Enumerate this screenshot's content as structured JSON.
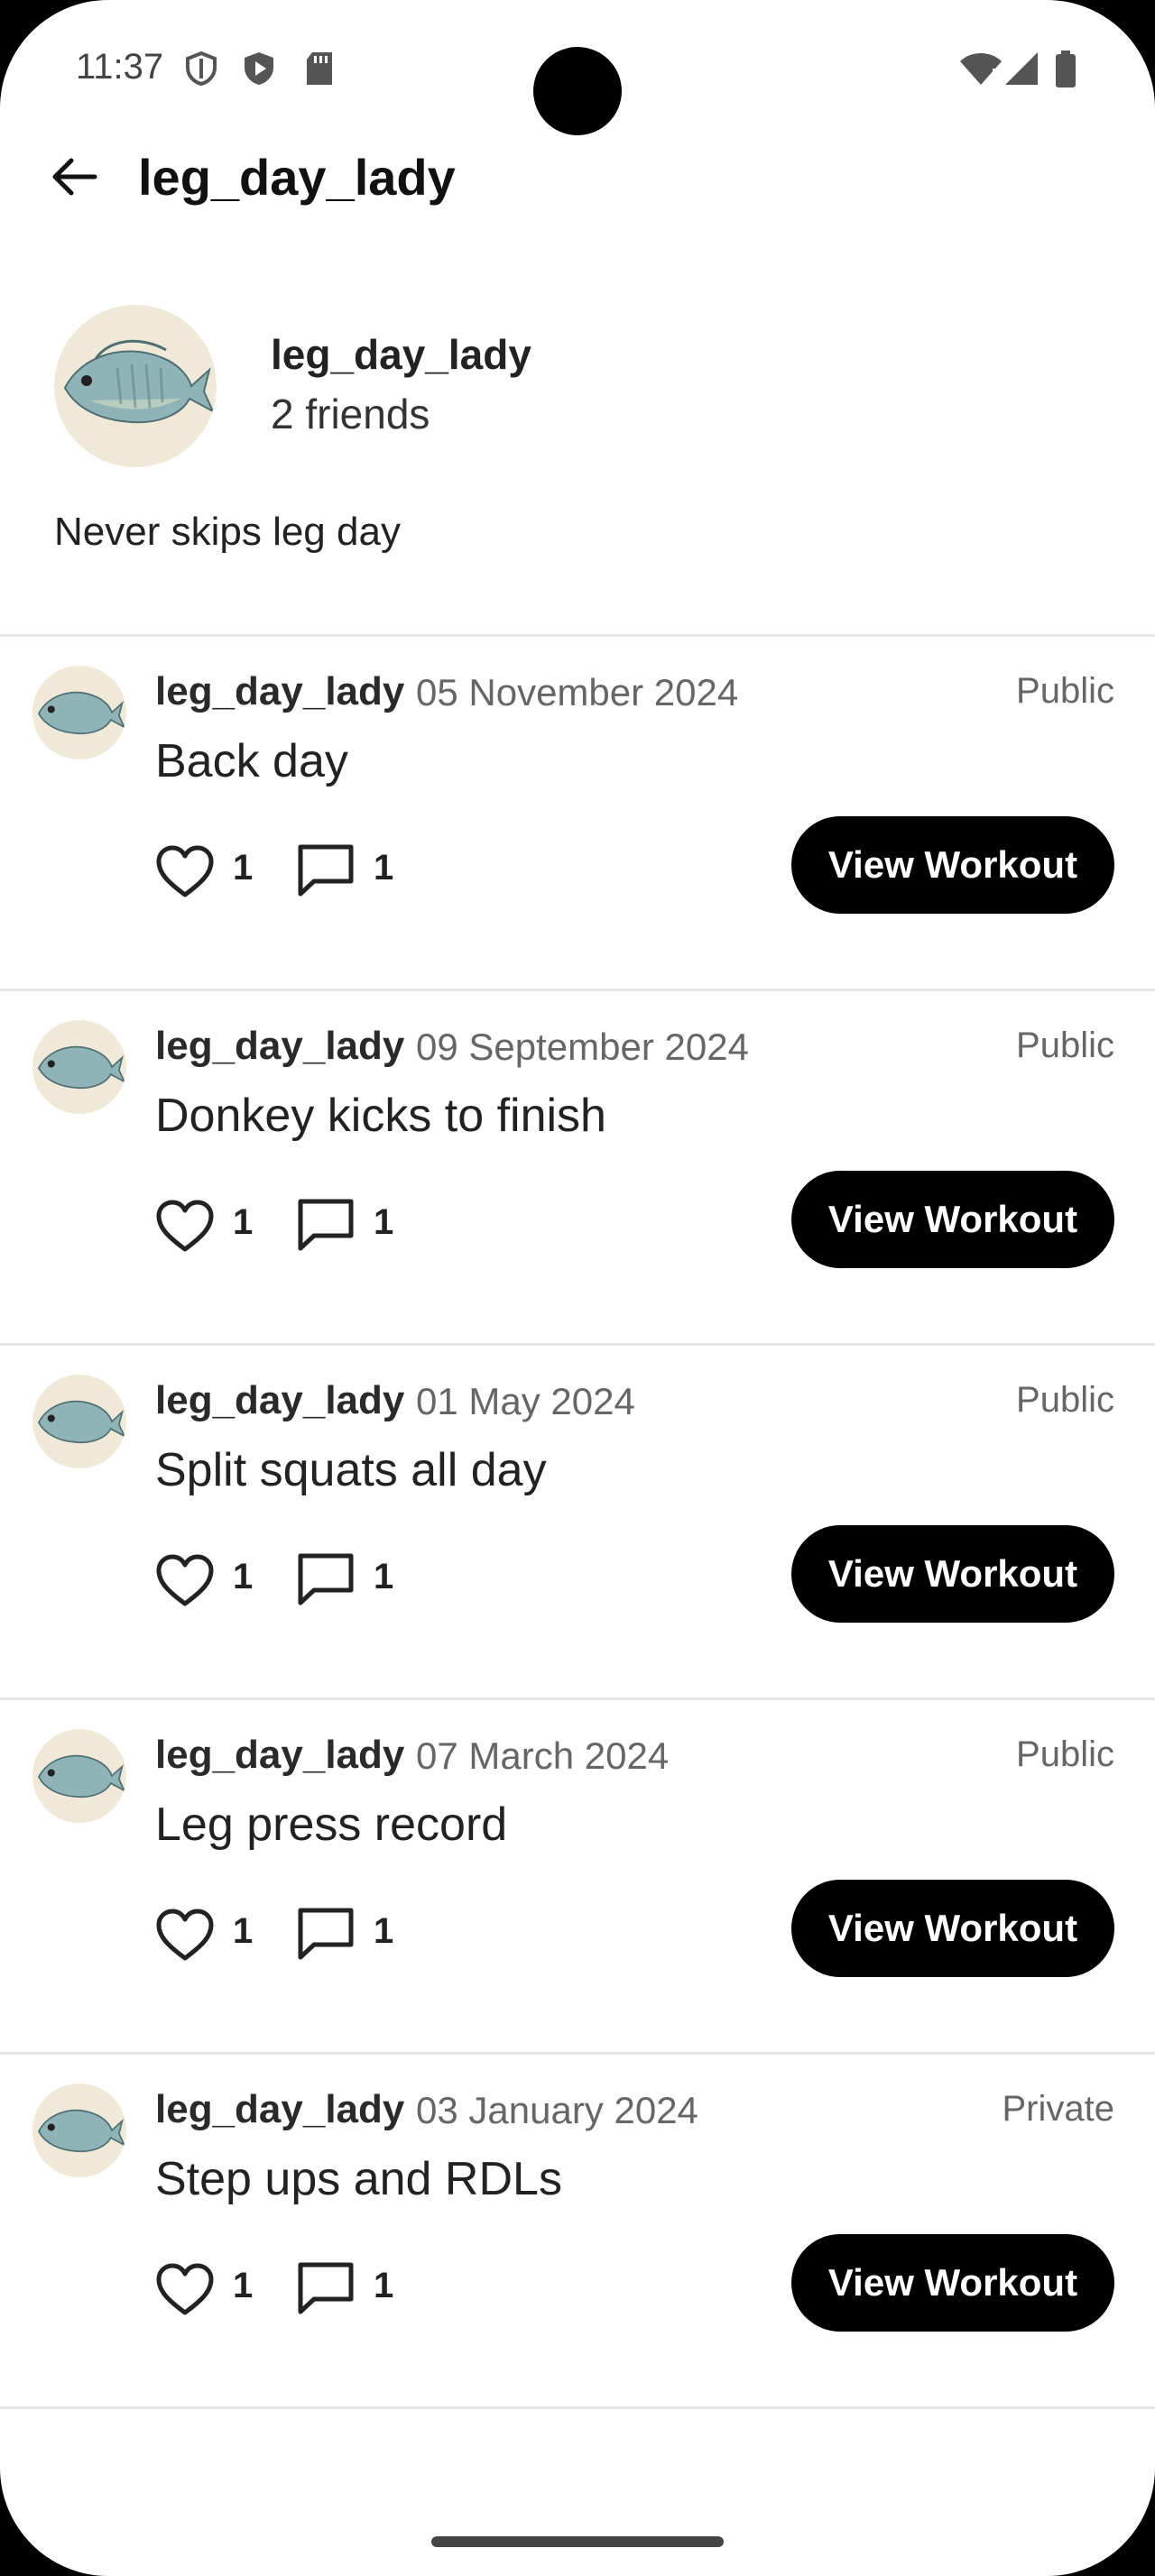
{
  "status_bar": {
    "time": "11:37",
    "icons": [
      "shield-icon",
      "play-protect-icon",
      "sd-card-icon",
      "wifi-icon",
      "cell-signal-icon",
      "battery-icon"
    ]
  },
  "app_bar": {
    "back_icon": "arrow-back-icon",
    "title": "leg_day_lady"
  },
  "profile": {
    "username": "leg_day_lady",
    "friends": "2 friends",
    "bio": "Never skips leg day",
    "avatar": "fish-avatar"
  },
  "posts": [
    {
      "user": "leg_day_lady",
      "date": "05 November 2024",
      "visibility": "Public",
      "title": "Back day",
      "likes": "1",
      "comments": "1",
      "button": "View Workout"
    },
    {
      "user": "leg_day_lady",
      "date": "09 September 2024",
      "visibility": "Public",
      "title": "Donkey kicks to finish",
      "likes": "1",
      "comments": "1",
      "button": "View Workout"
    },
    {
      "user": "leg_day_lady",
      "date": "01 May 2024",
      "visibility": "Public",
      "title": "Split squats all day",
      "likes": "1",
      "comments": "1",
      "button": "View Workout"
    },
    {
      "user": "leg_day_lady",
      "date": "07 March 2024",
      "visibility": "Public",
      "title": "Leg press record",
      "likes": "1",
      "comments": "1",
      "button": "View Workout"
    },
    {
      "user": "leg_day_lady",
      "date": "03 January 2024",
      "visibility": "Private",
      "title": "Step ups and RDLs",
      "likes": "1",
      "comments": "1",
      "button": "View Workout"
    }
  ],
  "colors": {
    "primary_button": "#000000",
    "avatar_bg": "#f1e9d8",
    "divider": "#e6e6e6"
  }
}
